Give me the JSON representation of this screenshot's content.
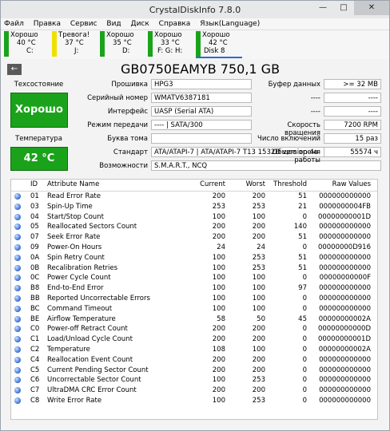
{
  "window": {
    "title": "CrystalDiskInfo 7.8.0",
    "minimize_glyph": "—",
    "maximize_glyph": "□",
    "close_glyph": "✕"
  },
  "menu": [
    "Файл",
    "Правка",
    "Сервис",
    "Вид",
    "Диск",
    "Справка",
    "Язык(Language)"
  ],
  "disks": [
    {
      "status": "Хорошо",
      "temp": "40 °C",
      "letter": "C:",
      "color": "#1aa31a"
    },
    {
      "status": "Тревога!",
      "temp": "37 °C",
      "letter": "J:",
      "color": "#f0e000"
    },
    {
      "status": "Хорошо",
      "temp": "35 °C",
      "letter": "D:",
      "color": "#1aa31a"
    },
    {
      "status": "Хорошо",
      "temp": "33 °C",
      "letter": "F: G: H:",
      "color": "#1aa31a"
    },
    {
      "status": "Хорошо",
      "temp": "42 °C",
      "letter": "Disk 8",
      "color": "#1aa31a"
    }
  ],
  "drive": {
    "back_glyph": "←",
    "model": "GB0750EAMYB 750,1 GB",
    "health_label": "Техсостояние",
    "health_value": "Хорошо",
    "temp_label": "Температура",
    "temp_value": "42 °C",
    "firmware_label": "Прошивка",
    "firmware": "HPG3",
    "serial_label": "Серийный номер",
    "serial": "WMATV6387181",
    "interface_label": "Интерфейс",
    "interface": "UASP (Serial ATA)",
    "transfer_label": "Режим передачи",
    "transfer": "---- | SATA/300",
    "letter_label": "Буква тома",
    "letter": "",
    "standard_label": "Стандарт",
    "standard": "ATA/ATAPI-7 | ATA/ATAPI-7 T13 1532D version 4a",
    "features_label": "Возможности",
    "features": "S.M.A.R.T., NCQ",
    "buffer_label": "Буфер данных",
    "buffer": ">= 32 MB",
    "blank1a": "----",
    "blank1b": "----",
    "blank2a": "----",
    "blank2b": "----",
    "rpm_label": "Скорость вращения",
    "rpm": "7200 RPM",
    "power_count_label": "Число включений",
    "power_count": "15 раз",
    "hours_label": "Общее время работы",
    "hours": "55574 ч"
  },
  "smart": {
    "headers": [
      "ID",
      "Attribute Name",
      "Current",
      "Worst",
      "Threshold",
      "Raw Values"
    ],
    "rows": [
      [
        "01",
        "Read Error Rate",
        "200",
        "200",
        "51",
        "000000000000"
      ],
      [
        "03",
        "Spin-Up Time",
        "253",
        "253",
        "21",
        "0000000004FB"
      ],
      [
        "04",
        "Start/Stop Count",
        "100",
        "100",
        "0",
        "00000000001D"
      ],
      [
        "05",
        "Reallocated Sectors Count",
        "200",
        "200",
        "140",
        "000000000000"
      ],
      [
        "07",
        "Seek Error Rate",
        "200",
        "200",
        "51",
        "000000000000"
      ],
      [
        "09",
        "Power-On Hours",
        "24",
        "24",
        "0",
        "00000000D916"
      ],
      [
        "0A",
        "Spin Retry Count",
        "100",
        "253",
        "51",
        "000000000000"
      ],
      [
        "0B",
        "Recalibration Retries",
        "100",
        "253",
        "51",
        "000000000000"
      ],
      [
        "0C",
        "Power Cycle Count",
        "100",
        "100",
        "0",
        "00000000000F"
      ],
      [
        "B8",
        "End-to-End Error",
        "100",
        "100",
        "97",
        "000000000000"
      ],
      [
        "BB",
        "Reported Uncorrectable Errors",
        "100",
        "100",
        "0",
        "000000000000"
      ],
      [
        "BC",
        "Command Timeout",
        "100",
        "100",
        "0",
        "000000000000"
      ],
      [
        "BE",
        "Airflow Temperature",
        "58",
        "50",
        "45",
        "00000000002A"
      ],
      [
        "C0",
        "Power-off Retract Count",
        "200",
        "200",
        "0",
        "00000000000D"
      ],
      [
        "C1",
        "Load/Unload Cycle Count",
        "200",
        "200",
        "0",
        "00000000001D"
      ],
      [
        "C2",
        "Temperature",
        "108",
        "100",
        "0",
        "00000000002A"
      ],
      [
        "C4",
        "Reallocation Event Count",
        "200",
        "200",
        "0",
        "000000000000"
      ],
      [
        "C5",
        "Current Pending Sector Count",
        "200",
        "200",
        "0",
        "000000000000"
      ],
      [
        "C6",
        "Uncorrectable Sector Count",
        "100",
        "253",
        "0",
        "000000000000"
      ],
      [
        "C7",
        "UltraDMA CRC Error Count",
        "200",
        "200",
        "0",
        "000000000000"
      ],
      [
        "C8",
        "Write Error Rate",
        "100",
        "253",
        "0",
        "000000000000"
      ]
    ]
  }
}
